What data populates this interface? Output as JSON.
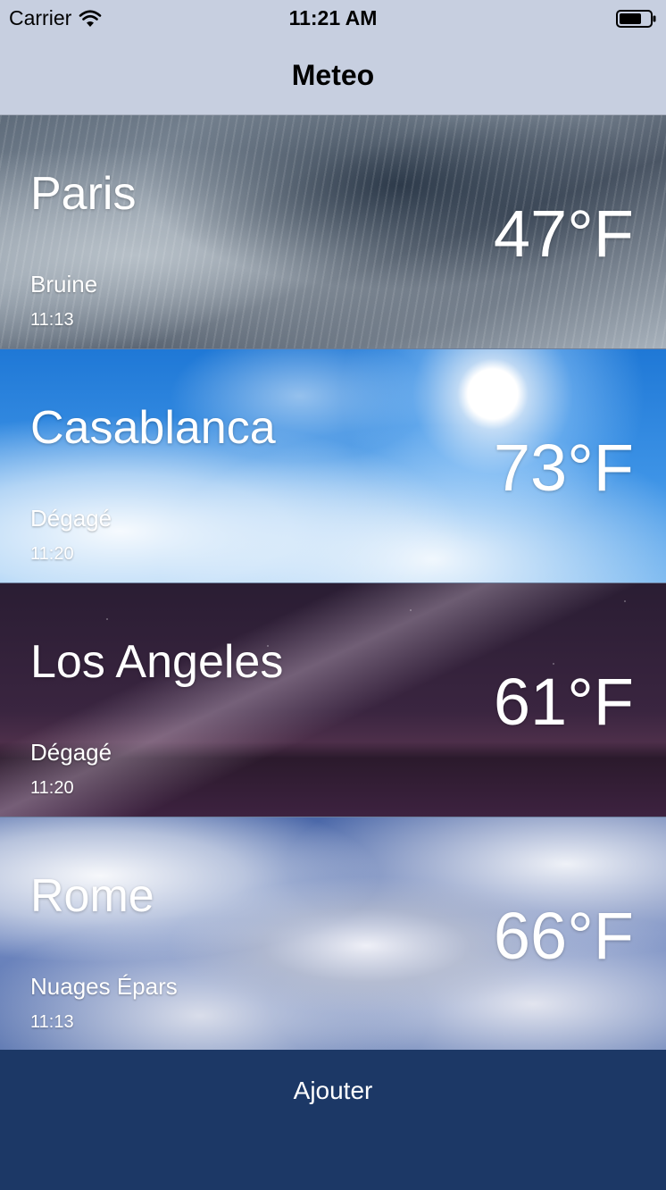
{
  "status_bar": {
    "carrier": "Carrier",
    "time": "11:21 AM"
  },
  "nav": {
    "title": "Meteo"
  },
  "cities": [
    {
      "name": "Paris",
      "temperature": "47°F",
      "condition": "Bruine",
      "time": "11:13"
    },
    {
      "name": "Casablanca",
      "temperature": "73°F",
      "condition": "Dégagé",
      "time": "11:20"
    },
    {
      "name": "Los Angeles",
      "temperature": "61°F",
      "condition": "Dégagé",
      "time": "11:20"
    },
    {
      "name": "Rome",
      "temperature": "66°F",
      "condition": "Nuages Épars",
      "time": "11:13"
    }
  ],
  "footer": {
    "add_label": "Ajouter"
  },
  "colors": {
    "nav_background": "#c7cfe0",
    "footer_background": "#1c3866"
  }
}
